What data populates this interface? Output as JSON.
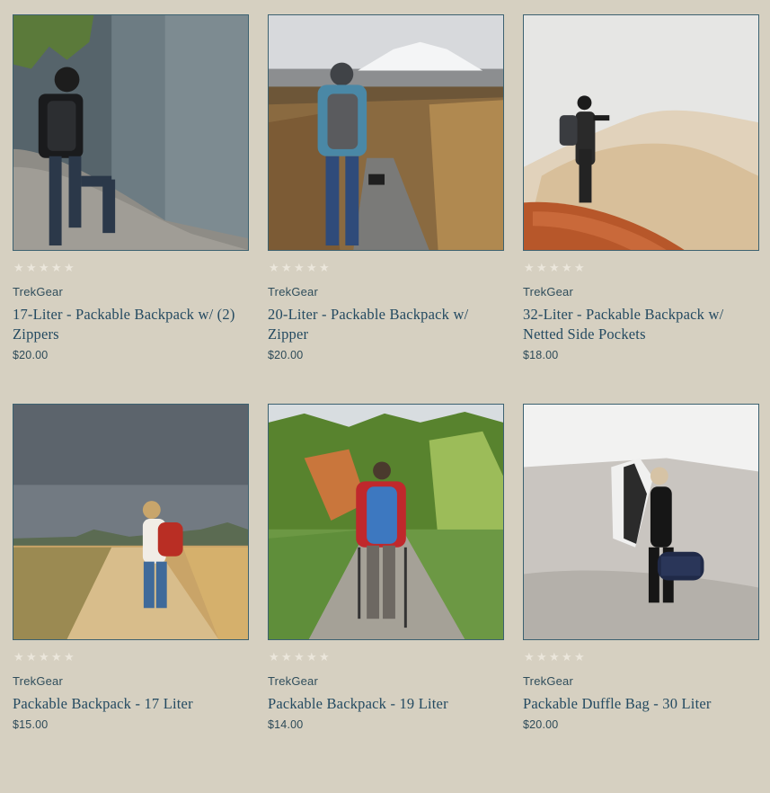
{
  "products": [
    {
      "title": "17-Liter - Packable Backpack w/ (2) Zippers",
      "vendor": "TrekGear",
      "price": "$20.00",
      "rating": 0,
      "image_alt": "Hiker with black backpack standing on rock",
      "image_icon": "product-image"
    },
    {
      "title": "20-Liter - Packable Backpack w/ Zipper",
      "vendor": "TrekGear",
      "price": "$20.00",
      "rating": 0,
      "image_alt": "Hiker with grey backpack walking toward snowy mountain",
      "image_icon": "product-image"
    },
    {
      "title": "32-Liter - Packable Backpack w/ Netted Side Pockets",
      "vendor": "TrekGear",
      "price": "$18.00",
      "rating": 0,
      "image_alt": "Photographer on rock formation with backpack",
      "image_icon": "product-image"
    },
    {
      "title": "Packable Backpack - 17 Liter",
      "vendor": "TrekGear",
      "price": "$15.00",
      "rating": 0,
      "image_alt": "Woman with red backpack walking on dirt road",
      "image_icon": "product-image"
    },
    {
      "title": "Packable Backpack - 19 Liter",
      "vendor": "TrekGear",
      "price": "$14.00",
      "rating": 0,
      "image_alt": "Hiker with blue backpack on forest trail",
      "image_icon": "product-image"
    },
    {
      "title": "Packable Duffle Bag - 30 Liter",
      "vendor": "TrekGear",
      "price": "$20.00",
      "rating": 0,
      "image_alt": "Woman carrying duffle bag and surfboard on beach",
      "image_icon": "product-image"
    }
  ],
  "colors": {
    "background": "#d6d0c1",
    "title": "#244a61",
    "vendor": "#2f4d5b",
    "price": "#2d4a58",
    "star_empty": "#ebe6db",
    "image_border": "#3c6170"
  },
  "star_count": 5,
  "star_glyph": "★"
}
